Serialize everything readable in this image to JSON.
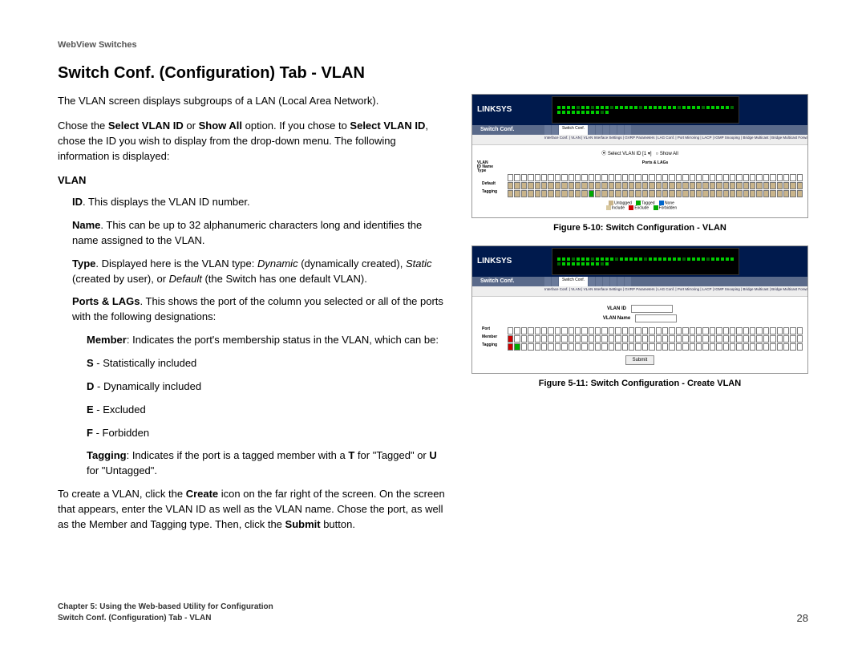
{
  "header": {
    "product": "WebView Switches"
  },
  "title": "Switch Conf. (Configuration) Tab - VLAN",
  "intro": "The VLAN screen displays subgroups of a LAN (Local Area Network).",
  "select_sentence": {
    "pre": "Chose the ",
    "b1": "Select VLAN ID",
    "mid1": " or ",
    "b2": "Show All",
    "mid2": " option. If you chose to ",
    "b3": "Select VLAN ID",
    "post": ", chose the ID you wish to display from the drop-down menu. The following information is displayed:"
  },
  "vlan_heading": "VLAN",
  "fields": {
    "id": {
      "label": "ID",
      "text": ". This displays the VLAN ID number."
    },
    "name": {
      "label": "Name",
      "text": ". This can be up to 32 alphanumeric characters long and identifies the name assigned to the VLAN."
    },
    "type": {
      "label": "Type",
      "pre": ". Displayed here is the VLAN type: ",
      "i1": "Dynamic",
      "t1": " (dynamically created), ",
      "i2": "Static",
      "t2": " (created by user), or ",
      "i3": "Default",
      "t3": " (the Switch has one default VLAN)."
    },
    "ports": {
      "label": "Ports & LAGs",
      "text": ". This shows the port of the column you selected or all of the ports with the following designations:"
    },
    "member": {
      "label": "Member",
      "text": ": Indicates the port's membership status in the VLAN, which can be:"
    },
    "s": {
      "b": "S",
      "t": " - Statistically included"
    },
    "d": {
      "b": "D",
      "t": " - Dynamically included"
    },
    "e": {
      "b": "E",
      "t": " - Excluded"
    },
    "f": {
      "b": "F",
      "t": " - Forbidden"
    },
    "tagging": {
      "label": "Tagging",
      "pre": ": Indicates if the port is a tagged member with a ",
      "b1": "T",
      "mid1": " for \"Tagged\" or ",
      "b2": "U",
      "post": " for \"Untagged\"."
    }
  },
  "create_para": {
    "pre": "To create a VLAN, click the ",
    "b1": "Create",
    "mid": " icon on the far right of the screen. On the screen that appears, enter the VLAN ID as well as the VLAN name. Chose the port, as well as the Member and Tagging type. Then, click the ",
    "b2": "Submit",
    "post": " button."
  },
  "figures": {
    "f10": "Figure 5-10: Switch Configuration - VLAN",
    "f11": "Figure 5-11: Switch Configuration - Create VLAN"
  },
  "mock": {
    "brand": "LINKSYS",
    "side_label": "Switch Conf.",
    "subnav": "Interface Conf. | VLAN | VLAN Interface Settings | GVRP Parameters | LAG Conf. | Port Mirroring | LACP | IGMP Snooping | Bridge Multicast | Bridge Multicast Forward All",
    "radio": {
      "sel": "Select VLAN ID",
      "val": "1",
      "all": "Show All"
    },
    "cols": {
      "c1a": "VLAN",
      "c1b": "ID",
      "c1c": "Name",
      "c1d": "Type",
      "c2": "Ports & LAGs"
    },
    "rows": {
      "member": "Member",
      "tagging": "Tagging",
      "default": "Default",
      "port": "Port"
    },
    "legend": {
      "untag": "Untagged",
      "tag": "Tagged",
      "none": "None",
      "inc": "Include",
      "exc": "Exclude",
      "forb": "Forbidden"
    },
    "form": {
      "id": "VLAN ID",
      "name": "VLAN Name",
      "submit": "Submit"
    }
  },
  "footer": {
    "line1": "Chapter 5: Using the Web-based Utility for Configuration",
    "line2": "Switch Conf. (Configuration) Tab - VLAN",
    "page": "28"
  }
}
